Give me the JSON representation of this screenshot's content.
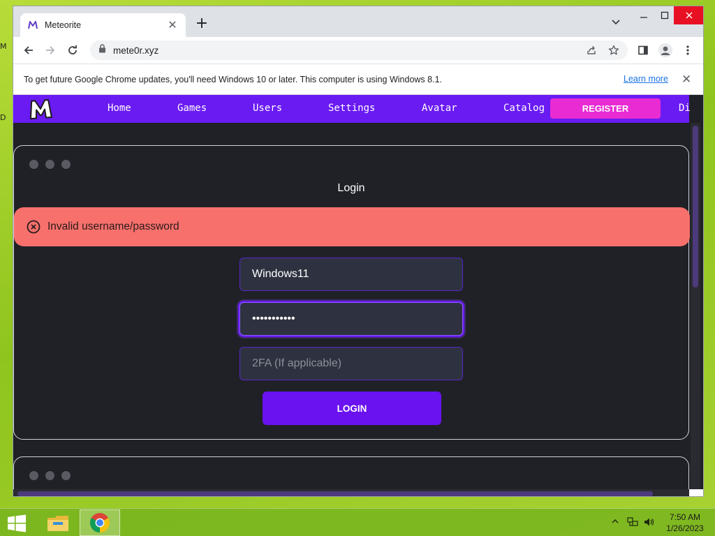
{
  "desktop": {
    "edge_fragments": [
      "M",
      "D"
    ]
  },
  "window": {
    "controls": [
      "minimize",
      "maximize",
      "close"
    ]
  },
  "tab": {
    "title": "Meteorite",
    "close_glyph": "✕",
    "new_tab_glyph": "+"
  },
  "toolbar": {
    "url": "mete0r.xyz"
  },
  "infobar": {
    "message": "To get future Google Chrome updates, you'll need Windows 10 or later. This computer is using Windows 8.1.",
    "link": "Learn more",
    "close_glyph": "✕"
  },
  "site": {
    "nav": [
      "Home",
      "Games",
      "Users",
      "Settings",
      "Avatar",
      "Catalog"
    ],
    "nav_overflow": "Di",
    "register_label": "REGISTER",
    "login_title": "Login",
    "alert_text": "Invalid username/password",
    "username_value": "Windows11",
    "password_mask": "•••••••••••",
    "twofa_placeholder": "2FA (If applicable)",
    "login_button": "LOGIN"
  },
  "colors": {
    "navbar": "#6a1bf2",
    "register": "#e82bd3",
    "alert": "#f7706c",
    "login_button": "#6a12f0",
    "page_bg": "#202127"
  },
  "taskbar": {
    "apps": [
      "file-explorer-icon",
      "chrome-icon"
    ],
    "time": "7:50 AM",
    "date": "1/26/2023"
  }
}
